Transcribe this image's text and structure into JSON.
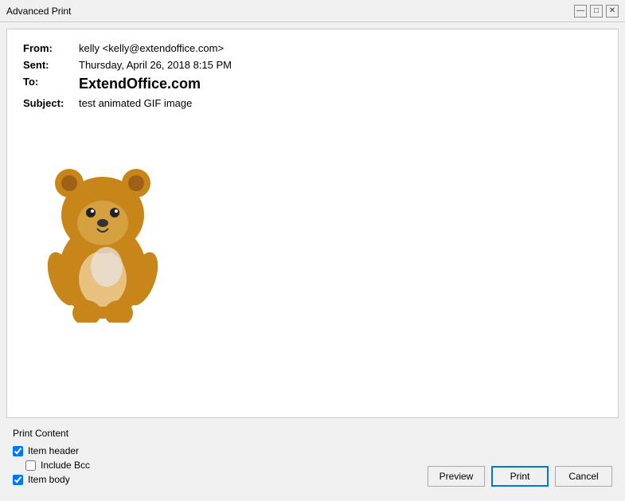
{
  "window": {
    "title": "Advanced Print",
    "minimize_label": "—",
    "maximize_label": "□",
    "close_label": "✕"
  },
  "email": {
    "from_label": "From:",
    "from_value": "kelly <kelly@extendoffice.com>",
    "sent_label": "Sent:",
    "sent_value": "Thursday, April 26, 2018 8:15 PM",
    "to_label": "To:",
    "to_value": "ExtendOffice.com",
    "subject_label": "Subject:",
    "subject_value": "test animated GIF image"
  },
  "print_content": {
    "section_label": "Print Content",
    "item_header_label": "Item header",
    "item_header_checked": true,
    "include_bcc_label": "Include Bcc",
    "include_bcc_checked": false,
    "item_body_label": "Item body",
    "item_body_checked": true
  },
  "buttons": {
    "preview_label": "Preview",
    "print_label": "Print",
    "cancel_label": "Cancel"
  }
}
